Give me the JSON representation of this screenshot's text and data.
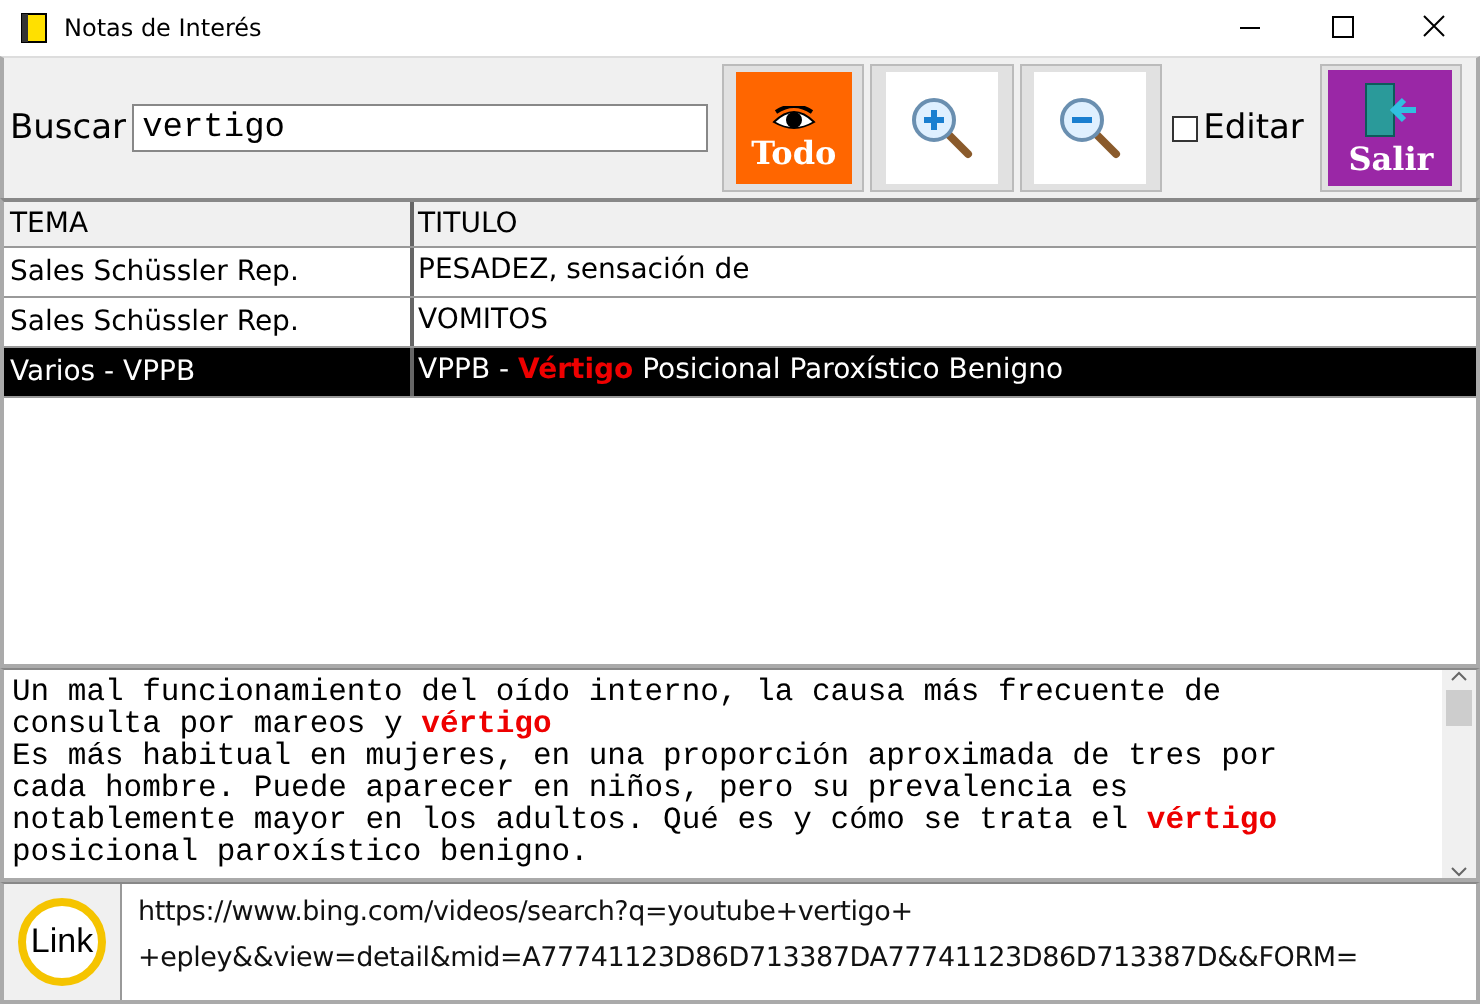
{
  "window": {
    "title": "Notas de Interés"
  },
  "toolbar": {
    "search_label": "Buscar",
    "search_value": "vertigo",
    "all_button": "Todo",
    "edit": {
      "label": "Editar",
      "checked": false
    },
    "exit_button": "Salir"
  },
  "table": {
    "columns": [
      "TEMA",
      "TITULO"
    ],
    "rows": [
      {
        "cells": [
          "Sales Schüssler Rep.",
          "PESADEZ, sensación de"
        ],
        "selected": false
      },
      {
        "cells": [
          "Sales Schüssler Rep.",
          "VOMITOS"
        ],
        "selected": false
      },
      {
        "cells": [
          "Varios - VPPB",
          "VPPB - **Vértigo** Posicional Paroxístico Benigno"
        ],
        "selected": true
      }
    ]
  },
  "notes": {
    "paragraphs": [
      "Un mal funcionamiento del oído interno, la causa más frecuente de consulta por mareos y **vértigo**",
      "Es más habitual en mujeres, en una proporción aproximada de tres por cada hombre. Puede aparecer en niños, pero su prevalencia es notablemente mayor en los adultos. Qué es y cómo se trata el **vértigo** posicional paroxístico benigno."
    ]
  },
  "link": {
    "button": "Link",
    "url": "https://www.bing.com/videos/search?q=youtube+vertigo+\n+epley&&view=detail&mid=A77741123D86D713387DA77741123D86D713387D&&FORM="
  }
}
